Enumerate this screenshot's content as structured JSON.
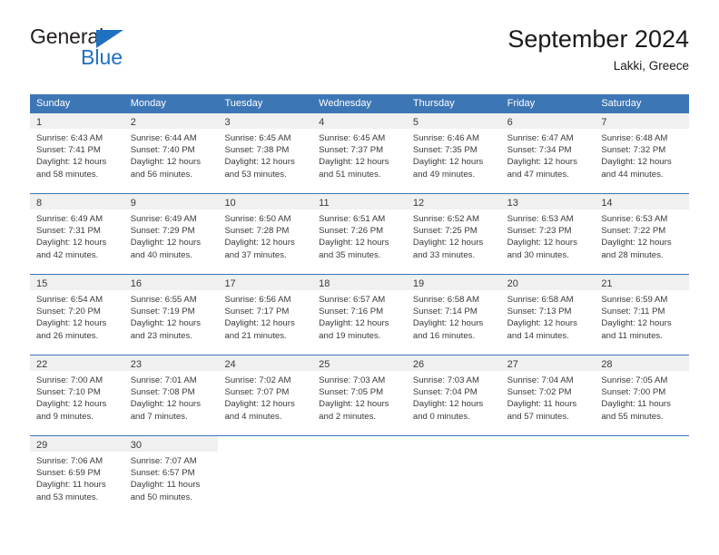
{
  "logo": {
    "word_top": "General",
    "word_bottom": "Blue",
    "triangle_color": "#1F70C1"
  },
  "header": {
    "title": "September 2024",
    "subtitle": "Lakki, Greece"
  },
  "colors": {
    "header_band": "#3D76B5",
    "date_band": "#F0F0F0",
    "text": "#3A3A3A"
  },
  "weekdays": [
    "Sunday",
    "Monday",
    "Tuesday",
    "Wednesday",
    "Thursday",
    "Friday",
    "Saturday"
  ],
  "weeks": [
    [
      {
        "date": "1",
        "sunrise": "Sunrise: 6:43 AM",
        "sunset": "Sunset: 7:41 PM",
        "daylight1": "Daylight: 12 hours",
        "daylight2": "and 58 minutes."
      },
      {
        "date": "2",
        "sunrise": "Sunrise: 6:44 AM",
        "sunset": "Sunset: 7:40 PM",
        "daylight1": "Daylight: 12 hours",
        "daylight2": "and 56 minutes."
      },
      {
        "date": "3",
        "sunrise": "Sunrise: 6:45 AM",
        "sunset": "Sunset: 7:38 PM",
        "daylight1": "Daylight: 12 hours",
        "daylight2": "and 53 minutes."
      },
      {
        "date": "4",
        "sunrise": "Sunrise: 6:45 AM",
        "sunset": "Sunset: 7:37 PM",
        "daylight1": "Daylight: 12 hours",
        "daylight2": "and 51 minutes."
      },
      {
        "date": "5",
        "sunrise": "Sunrise: 6:46 AM",
        "sunset": "Sunset: 7:35 PM",
        "daylight1": "Daylight: 12 hours",
        "daylight2": "and 49 minutes."
      },
      {
        "date": "6",
        "sunrise": "Sunrise: 6:47 AM",
        "sunset": "Sunset: 7:34 PM",
        "daylight1": "Daylight: 12 hours",
        "daylight2": "and 47 minutes."
      },
      {
        "date": "7",
        "sunrise": "Sunrise: 6:48 AM",
        "sunset": "Sunset: 7:32 PM",
        "daylight1": "Daylight: 12 hours",
        "daylight2": "and 44 minutes."
      }
    ],
    [
      {
        "date": "8",
        "sunrise": "Sunrise: 6:49 AM",
        "sunset": "Sunset: 7:31 PM",
        "daylight1": "Daylight: 12 hours",
        "daylight2": "and 42 minutes."
      },
      {
        "date": "9",
        "sunrise": "Sunrise: 6:49 AM",
        "sunset": "Sunset: 7:29 PM",
        "daylight1": "Daylight: 12 hours",
        "daylight2": "and 40 minutes."
      },
      {
        "date": "10",
        "sunrise": "Sunrise: 6:50 AM",
        "sunset": "Sunset: 7:28 PM",
        "daylight1": "Daylight: 12 hours",
        "daylight2": "and 37 minutes."
      },
      {
        "date": "11",
        "sunrise": "Sunrise: 6:51 AM",
        "sunset": "Sunset: 7:26 PM",
        "daylight1": "Daylight: 12 hours",
        "daylight2": "and 35 minutes."
      },
      {
        "date": "12",
        "sunrise": "Sunrise: 6:52 AM",
        "sunset": "Sunset: 7:25 PM",
        "daylight1": "Daylight: 12 hours",
        "daylight2": "and 33 minutes."
      },
      {
        "date": "13",
        "sunrise": "Sunrise: 6:53 AM",
        "sunset": "Sunset: 7:23 PM",
        "daylight1": "Daylight: 12 hours",
        "daylight2": "and 30 minutes."
      },
      {
        "date": "14",
        "sunrise": "Sunrise: 6:53 AM",
        "sunset": "Sunset: 7:22 PM",
        "daylight1": "Daylight: 12 hours",
        "daylight2": "and 28 minutes."
      }
    ],
    [
      {
        "date": "15",
        "sunrise": "Sunrise: 6:54 AM",
        "sunset": "Sunset: 7:20 PM",
        "daylight1": "Daylight: 12 hours",
        "daylight2": "and 26 minutes."
      },
      {
        "date": "16",
        "sunrise": "Sunrise: 6:55 AM",
        "sunset": "Sunset: 7:19 PM",
        "daylight1": "Daylight: 12 hours",
        "daylight2": "and 23 minutes."
      },
      {
        "date": "17",
        "sunrise": "Sunrise: 6:56 AM",
        "sunset": "Sunset: 7:17 PM",
        "daylight1": "Daylight: 12 hours",
        "daylight2": "and 21 minutes."
      },
      {
        "date": "18",
        "sunrise": "Sunrise: 6:57 AM",
        "sunset": "Sunset: 7:16 PM",
        "daylight1": "Daylight: 12 hours",
        "daylight2": "and 19 minutes."
      },
      {
        "date": "19",
        "sunrise": "Sunrise: 6:58 AM",
        "sunset": "Sunset: 7:14 PM",
        "daylight1": "Daylight: 12 hours",
        "daylight2": "and 16 minutes."
      },
      {
        "date": "20",
        "sunrise": "Sunrise: 6:58 AM",
        "sunset": "Sunset: 7:13 PM",
        "daylight1": "Daylight: 12 hours",
        "daylight2": "and 14 minutes."
      },
      {
        "date": "21",
        "sunrise": "Sunrise: 6:59 AM",
        "sunset": "Sunset: 7:11 PM",
        "daylight1": "Daylight: 12 hours",
        "daylight2": "and 11 minutes."
      }
    ],
    [
      {
        "date": "22",
        "sunrise": "Sunrise: 7:00 AM",
        "sunset": "Sunset: 7:10 PM",
        "daylight1": "Daylight: 12 hours",
        "daylight2": "and 9 minutes."
      },
      {
        "date": "23",
        "sunrise": "Sunrise: 7:01 AM",
        "sunset": "Sunset: 7:08 PM",
        "daylight1": "Daylight: 12 hours",
        "daylight2": "and 7 minutes."
      },
      {
        "date": "24",
        "sunrise": "Sunrise: 7:02 AM",
        "sunset": "Sunset: 7:07 PM",
        "daylight1": "Daylight: 12 hours",
        "daylight2": "and 4 minutes."
      },
      {
        "date": "25",
        "sunrise": "Sunrise: 7:03 AM",
        "sunset": "Sunset: 7:05 PM",
        "daylight1": "Daylight: 12 hours",
        "daylight2": "and 2 minutes."
      },
      {
        "date": "26",
        "sunrise": "Sunrise: 7:03 AM",
        "sunset": "Sunset: 7:04 PM",
        "daylight1": "Daylight: 12 hours",
        "daylight2": "and 0 minutes."
      },
      {
        "date": "27",
        "sunrise": "Sunrise: 7:04 AM",
        "sunset": "Sunset: 7:02 PM",
        "daylight1": "Daylight: 11 hours",
        "daylight2": "and 57 minutes."
      },
      {
        "date": "28",
        "sunrise": "Sunrise: 7:05 AM",
        "sunset": "Sunset: 7:00 PM",
        "daylight1": "Daylight: 11 hours",
        "daylight2": "and 55 minutes."
      }
    ],
    [
      {
        "date": "29",
        "sunrise": "Sunrise: 7:06 AM",
        "sunset": "Sunset: 6:59 PM",
        "daylight1": "Daylight: 11 hours",
        "daylight2": "and 53 minutes."
      },
      {
        "date": "30",
        "sunrise": "Sunrise: 7:07 AM",
        "sunset": "Sunset: 6:57 PM",
        "daylight1": "Daylight: 11 hours",
        "daylight2": "and 50 minutes."
      },
      {
        "date": "",
        "sunrise": "",
        "sunset": "",
        "daylight1": "",
        "daylight2": ""
      },
      {
        "date": "",
        "sunrise": "",
        "sunset": "",
        "daylight1": "",
        "daylight2": ""
      },
      {
        "date": "",
        "sunrise": "",
        "sunset": "",
        "daylight1": "",
        "daylight2": ""
      },
      {
        "date": "",
        "sunrise": "",
        "sunset": "",
        "daylight1": "",
        "daylight2": ""
      },
      {
        "date": "",
        "sunrise": "",
        "sunset": "",
        "daylight1": "",
        "daylight2": ""
      }
    ]
  ]
}
